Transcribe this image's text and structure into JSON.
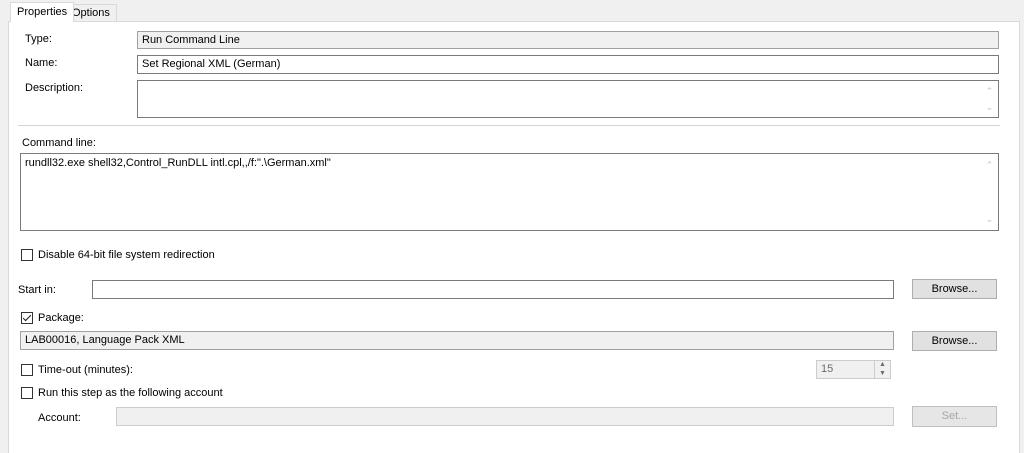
{
  "tabs": [
    {
      "label": "Properties"
    },
    {
      "label": "Options"
    }
  ],
  "type": {
    "label": "Type:",
    "value": "Run Command Line"
  },
  "name": {
    "label": "Name:",
    "value": "Set Regional XML (German)"
  },
  "description": {
    "label": "Description:",
    "value": ""
  },
  "command_line": {
    "label": "Command line:",
    "value": "rundll32.exe shell32,Control_RunDLL intl.cpl,,/f:\".\\German.xml\""
  },
  "disable_redirection": {
    "label": "Disable 64-bit file system redirection",
    "checked": false
  },
  "start_in": {
    "label": "Start in:",
    "value": "",
    "browse_label": "Browse..."
  },
  "package": {
    "label": "Package:",
    "checked": true,
    "value": "LAB00016, Language Pack XML",
    "browse_label": "Browse..."
  },
  "timeout": {
    "label": "Time-out (minutes):",
    "checked": false,
    "value": "15"
  },
  "run_as": {
    "label": "Run this step as the following account",
    "checked": false
  },
  "account": {
    "label": "Account:",
    "value": "",
    "set_label": "Set..."
  },
  "icons": {
    "scroll_up": "chevron-up-icon",
    "scroll_down": "chevron-down-icon",
    "check": "checkmark-icon"
  }
}
